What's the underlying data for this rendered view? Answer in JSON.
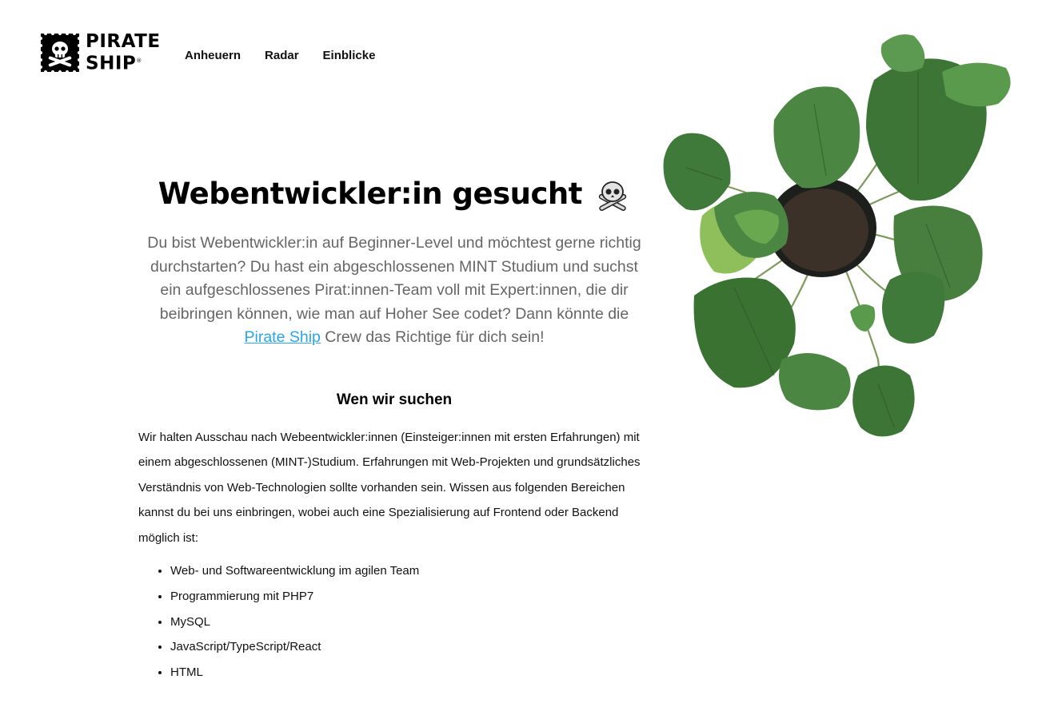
{
  "brand": {
    "line1": "PIRATE",
    "line2": "SHIP",
    "mark": "®"
  },
  "nav": [
    {
      "label": "Anheuern"
    },
    {
      "label": "Radar"
    },
    {
      "label": "Einblicke"
    }
  ],
  "hero": {
    "title": "Webentwickler:in gesucht",
    "title_icon": "skull-crossbones-icon",
    "intro_before": "Du bist Webentwickler:in auf Beginner-Level und möchtest gerne richtig durchstarten? Du hast ein abgeschlossenen MINT Studium und suchst ein aufgeschlossenes Pirat:innen-Team voll mit Expert:innen, die dir beibringen können, wie man auf Hoher See codet? Dann könnte die ",
    "intro_link": "Pirate Ship",
    "intro_after": " Crew das Richtige für dich sein!"
  },
  "section": {
    "heading": "Wen wir suchen",
    "paragraph": "Wir halten Ausschau nach Webeentwickler:innen (Einsteiger:innen mit ersten Erfahrungen) mit einem abgeschlossenen (MINT-)Studium. Erfahrungen mit Web-Projekten und grundsätzliches Verständnis von Web-Technologien sollte vorhanden sein. Wissen aus folgenden Bereichen kannst du bei uns einbringen, wobei auch eine Spezialisierung auf Frontend oder Backend möglich ist:",
    "skills": [
      "Web- und Softwareentwicklung im agilen Team",
      "Programmierung mit PHP7",
      "MySQL",
      "JavaScript/TypeScript/React",
      "HTML"
    ]
  },
  "colors": {
    "link": "#2ba6e6",
    "text": "#111111",
    "muted": "#666666",
    "leaf": "#3f7a3a"
  },
  "image": {
    "plant": "potted-plant-image"
  }
}
